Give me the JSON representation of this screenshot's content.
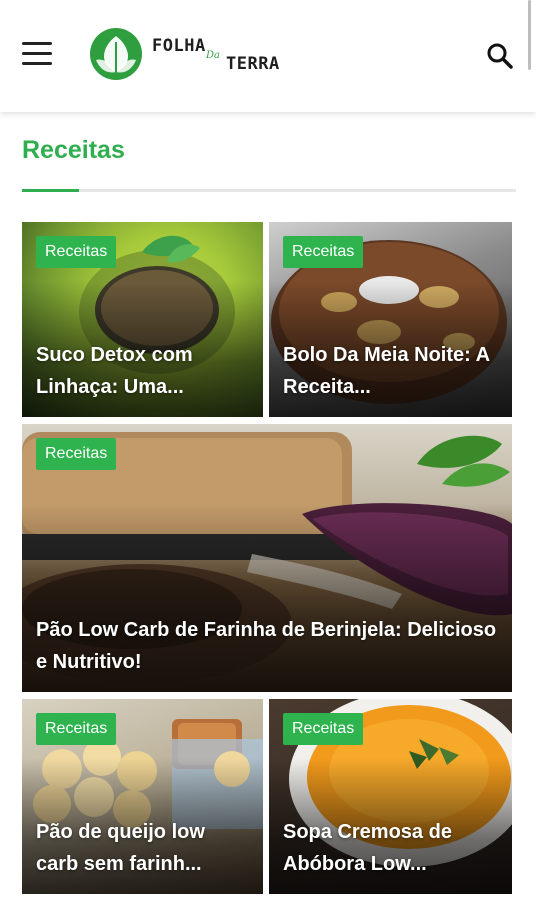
{
  "header": {
    "logo_top": "FOLHA",
    "logo_da": "Da",
    "logo_bottom": "TERRA"
  },
  "section": {
    "title": "Receitas"
  },
  "cards": [
    {
      "badge": "Receitas",
      "title": "Suco Detox com Linhaça: Uma..."
    },
    {
      "badge": "Receitas",
      "title": "Bolo Da Meia Noite: A Receita..."
    },
    {
      "badge": "Receitas",
      "title": "Pão Low Carb de Farinha de Berinjela: Delicioso e Nutritivo!"
    },
    {
      "badge": "Receitas",
      "title": "Pão de queijo low carb sem farinh..."
    },
    {
      "badge": "Receitas",
      "title": "Sopa Cremosa de Abóbora Low..."
    }
  ],
  "colors": {
    "accent": "#2fae4f",
    "badge_bg": "#2fb34f"
  }
}
